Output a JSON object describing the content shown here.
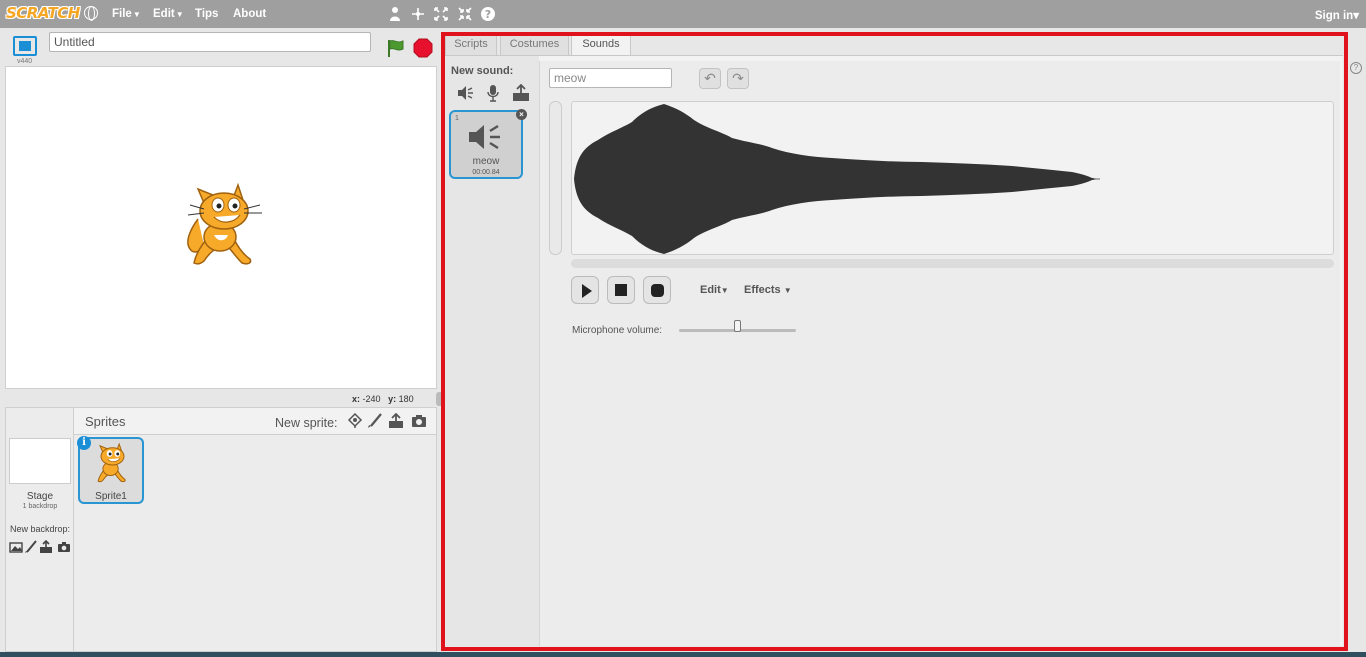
{
  "menubar": {
    "logo": "SCRATCH",
    "menus": [
      {
        "label": "File",
        "has_caret": true
      },
      {
        "label": "Edit",
        "has_caret": true
      },
      {
        "label": "Tips",
        "has_caret": false
      },
      {
        "label": "About",
        "has_caret": false
      }
    ],
    "tools": [
      "duplicate-icon",
      "cut-icon",
      "grow-icon",
      "shrink-icon",
      "help-icon"
    ],
    "signin": "Sign in",
    "signin_caret": "▾"
  },
  "stage_header": {
    "version": "v440",
    "project_title": "Untitled"
  },
  "coords": {
    "x_label": "x:",
    "x_value": "-240",
    "y_label": "y:",
    "y_value": "180"
  },
  "sprites_pane": {
    "title": "Sprites",
    "new_sprite_label": "New sprite:",
    "stage_label": "Stage",
    "stage_sub": "1 backdrop",
    "new_backdrop_label": "New backdrop:",
    "sprites": [
      {
        "name": "Sprite1",
        "selected": true
      }
    ]
  },
  "tabs": [
    {
      "label": "Scripts",
      "active": false
    },
    {
      "label": "Costumes",
      "active": false
    },
    {
      "label": "Sounds",
      "active": true
    }
  ],
  "sound_list": {
    "new_sound_label": "New sound:",
    "sounds": [
      {
        "index": "1",
        "name": "meow",
        "duration": "00:00.84",
        "selected": true
      }
    ]
  },
  "sound_editor": {
    "name_value": "meow",
    "controls": {
      "edit_label": "Edit",
      "effects_label": "Effects"
    },
    "mic_label": "Microphone volume:",
    "mic_volume_fraction": 0.5
  },
  "colors": {
    "accent_blue": "#2a95d3",
    "highlight_red": "#e0121b",
    "menubar_gray": "#9f9f9f"
  }
}
